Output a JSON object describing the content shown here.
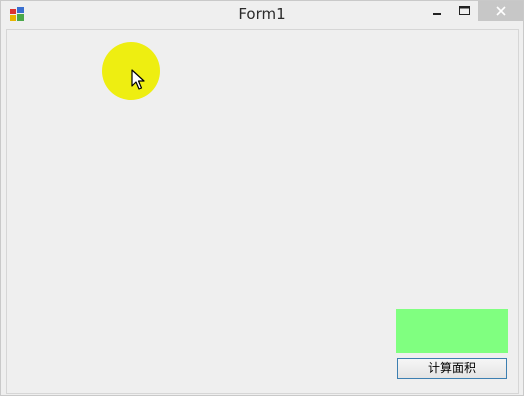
{
  "window": {
    "title": "Form1",
    "close_glyph": "✕",
    "icons": {
      "app": "app-form-icon",
      "minimize": "minimize-icon",
      "maximize": "maximize-icon",
      "close": "close-icon",
      "cursor": "mouse-cursor-icon"
    }
  },
  "canvas": {
    "circle_color": "#eeee11",
    "rect_color": "#80ff80"
  },
  "button": {
    "label": "计算面积"
  }
}
